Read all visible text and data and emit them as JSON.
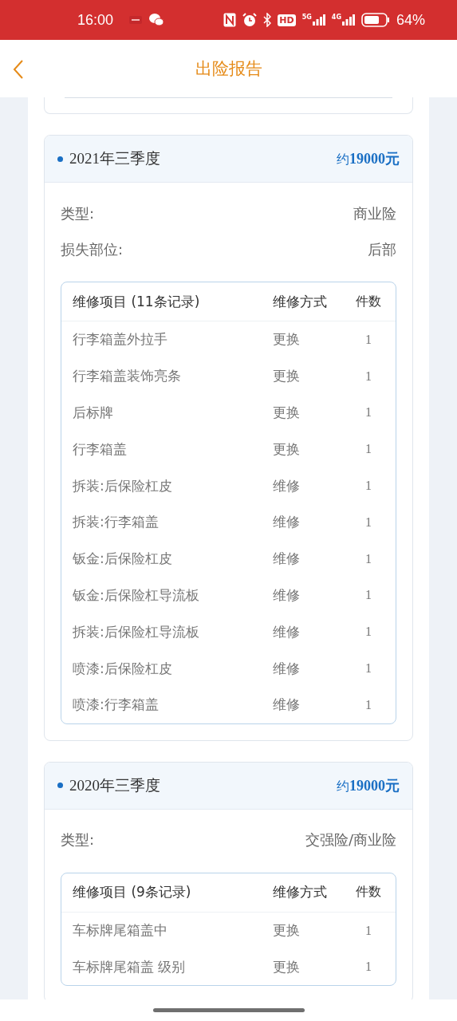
{
  "status_bar": {
    "time": "16:00",
    "hd": "HD",
    "network_1": "5G",
    "network_2": "4G",
    "battery": "64%"
  },
  "header": {
    "title": "出险报告"
  },
  "claims": [
    {
      "period": "2021年三季度",
      "amount_prefix": "约",
      "amount": "19000元",
      "fields": [
        {
          "label": "类型:",
          "value": "商业险"
        },
        {
          "label": "损失部位:",
          "value": "后部"
        }
      ],
      "table": {
        "columns": [
          "维修项目 (11条记录)",
          "维修方式",
          "件数"
        ],
        "rows": [
          [
            "行李箱盖外拉手",
            "更换",
            "1"
          ],
          [
            "行李箱盖装饰亮条",
            "更换",
            "1"
          ],
          [
            "后标牌",
            "更换",
            "1"
          ],
          [
            "行李箱盖",
            "更换",
            "1"
          ],
          [
            "拆装:后保险杠皮",
            "维修",
            "1"
          ],
          [
            "拆装:行李箱盖",
            "维修",
            "1"
          ],
          [
            "钣金:后保险杠皮",
            "维修",
            "1"
          ],
          [
            "钣金:后保险杠导流板",
            "维修",
            "1"
          ],
          [
            "拆装:后保险杠导流板",
            "维修",
            "1"
          ],
          [
            "喷漆:后保险杠皮",
            "维修",
            "1"
          ],
          [
            "喷漆:行李箱盖",
            "维修",
            "1"
          ]
        ]
      }
    },
    {
      "period": "2020年三季度",
      "amount_prefix": "约",
      "amount": "19000元",
      "fields": [
        {
          "label": "类型:",
          "value": "交强险/商业险"
        }
      ],
      "table": {
        "columns": [
          "维修项目 (9条记录)",
          "维修方式",
          "件数"
        ],
        "rows": [
          [
            "车标牌尾箱盖中",
            "更换",
            "1"
          ],
          [
            "车标牌尾箱盖 级别",
            "更换",
            "1"
          ]
        ]
      }
    }
  ]
}
